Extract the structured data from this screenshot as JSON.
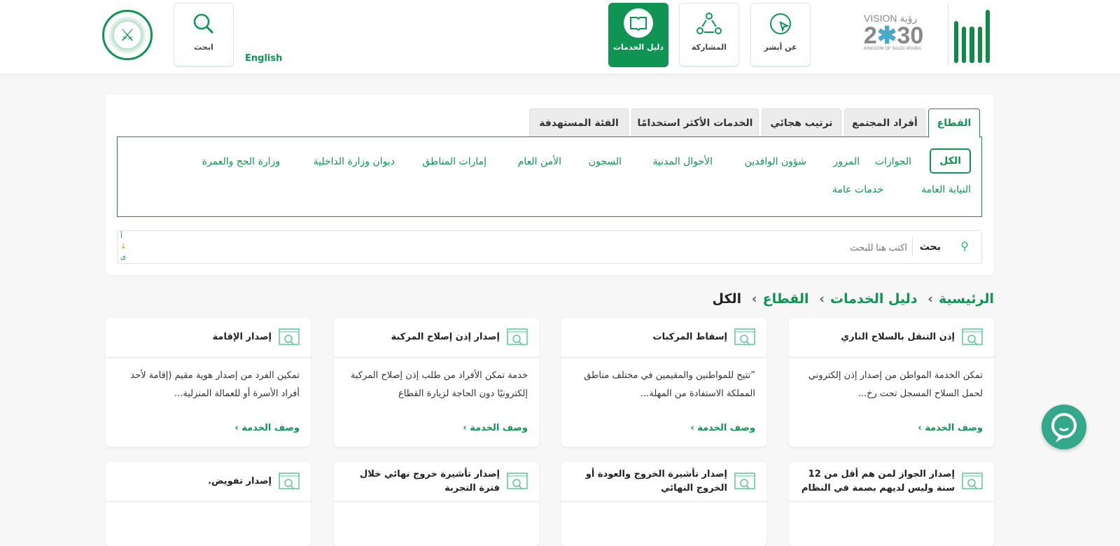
{
  "header": {
    "nav": [
      {
        "label": "عن أبشر",
        "icon": "cursor-circle-icon"
      },
      {
        "label": "المشاركة",
        "icon": "share-people-icon"
      },
      {
        "label": "دليل الخدمات",
        "icon": "book-icon",
        "active": true
      }
    ],
    "search_label": "ابحث",
    "language": "English",
    "logo_vision": "VISION 2030 رؤية المملكة العربية السعودية KINGDOM OF SAUDI ARABIA",
    "logo_absher": "أبشر"
  },
  "tabs": [
    {
      "label": "القطاع",
      "active": true
    },
    {
      "label": "أفراد المجتمع"
    },
    {
      "label": "ترتيب هجائي"
    },
    {
      "label": "الخدمات الأكثر استخدامًا"
    },
    {
      "label": "الفئة المستهدفة"
    }
  ],
  "filters": [
    "الكل",
    "الجوازات",
    "المرور",
    "شؤون الوافدين",
    "الأحوال المدنية",
    "السجون",
    "الأمن العام",
    "إمارات المناطق",
    "ديوان وزارة الداخلية",
    "وزارة الحج والعمرة",
    "النيابة العامة",
    "خدمات عامة"
  ],
  "search": {
    "label": "بحث",
    "placeholder": "اكتب هنا للبحث",
    "sort": [
      "أ",
      "↓",
      "ى"
    ]
  },
  "breadcrumb": [
    "الرئيسية",
    "دليل الخدمات",
    "القطاع",
    "الكل"
  ],
  "link_label": "وصف الخدمة ›",
  "cards": [
    {
      "title": "إذن التنقل بالسلاح الناري",
      "desc": "تمكن الخدمة المواطن من إصدار إذن إلكتروني لحمل السلاح المسجل تحت رخ..."
    },
    {
      "title": "إسقاط المركبات",
      "desc": "”تتيح للمواطنين والمقيمين في مختلف مناطق المملكة الاستفادة من المهلة..."
    },
    {
      "title": "إصدار إذن إصلاح المركبة",
      "desc": "خدمة تمكن الأفراد من طلب إذن إصلاح المركبة إلكترونيًا دون الحاجة لزيارة القطاع"
    },
    {
      "title": "إصدار الإقامة",
      "desc": "تمكين الفرد من إصدار هوية مقيم (إقامة لأحد أفراد الأسرة أو للعمالة المنزلية..."
    },
    {
      "title": "إصدار الجواز لمن هم أقل من 12 سنة وليس لديهم بصمة في النظام"
    },
    {
      "title": "إصدار تأشيرة الخروج والعودة أو الخروج النهائي"
    },
    {
      "title": "إصدار تأشيرة خروج نهائي خلال فترة التجربة"
    },
    {
      "title": "إصدار تفويض."
    }
  ],
  "colors": {
    "primary": "#109454",
    "chat": "#34a88a"
  }
}
